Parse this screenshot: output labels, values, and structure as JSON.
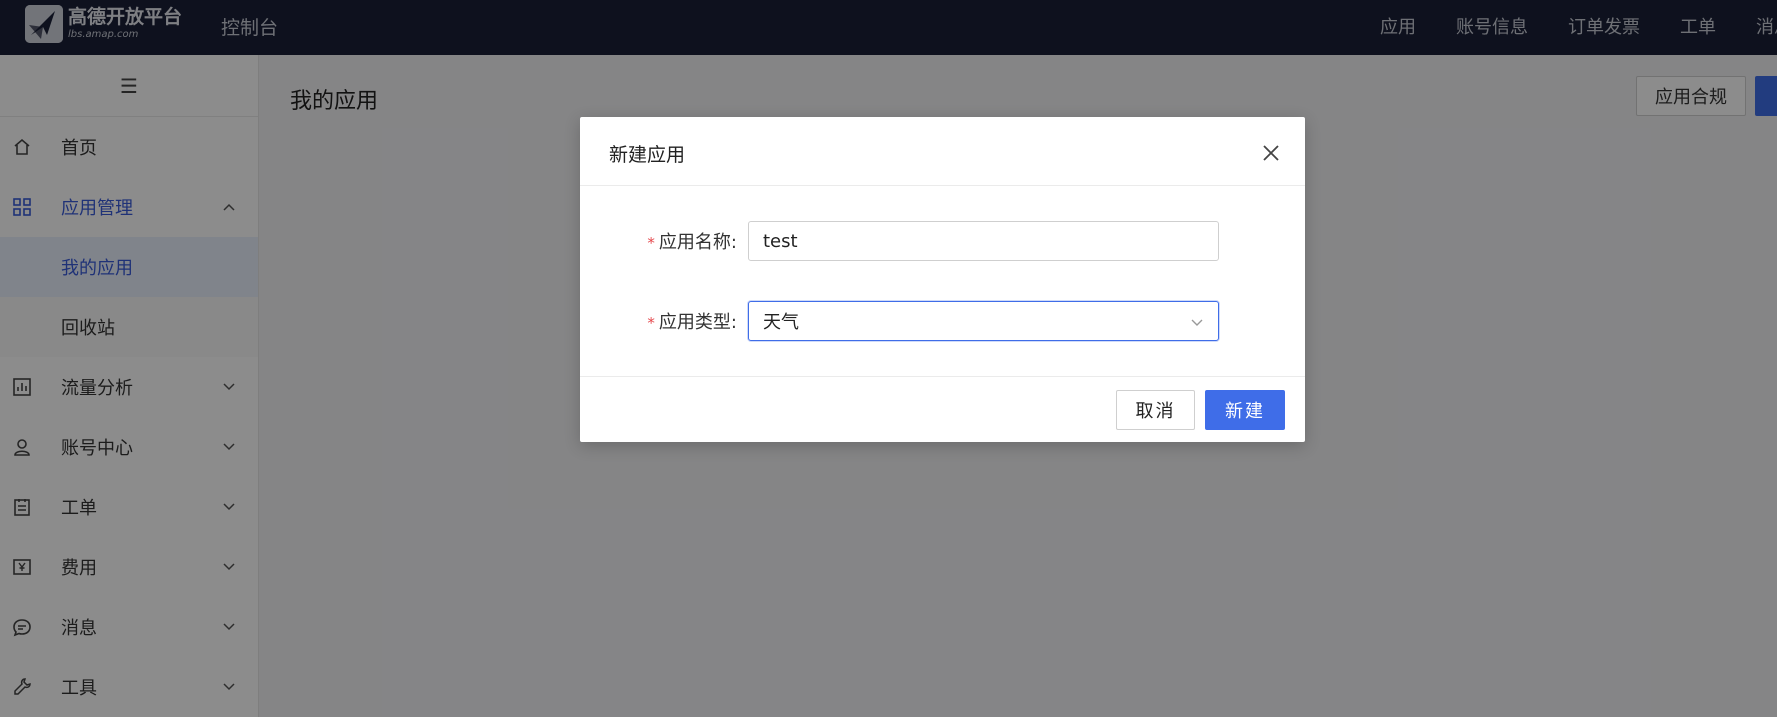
{
  "topbar": {
    "logo_cn": "高德开放平台",
    "logo_en": "lbs.amap.com",
    "console": "控制台",
    "nav": [
      "应用",
      "账号信息",
      "订单发票",
      "工单",
      "消息"
    ]
  },
  "sidebar": {
    "items": [
      {
        "label": "首页",
        "icon": "home-icon"
      },
      {
        "label": "应用管理",
        "icon": "grid-icon",
        "expanded": true
      },
      {
        "label": "我的应用",
        "sub": true,
        "selected": true
      },
      {
        "label": "回收站",
        "sub": true
      },
      {
        "label": "流量分析",
        "icon": "chart-icon"
      },
      {
        "label": "账号中心",
        "icon": "user-icon"
      },
      {
        "label": "工单",
        "icon": "ticket-icon"
      },
      {
        "label": "费用",
        "icon": "yen-icon"
      },
      {
        "label": "消息",
        "icon": "message-icon"
      },
      {
        "label": "工具",
        "icon": "wrench-icon"
      }
    ]
  },
  "main": {
    "title": "我的应用",
    "compliance_button": "应用合规"
  },
  "dialog": {
    "title": "新建应用",
    "name_label": "应用名称:",
    "name_value": "test",
    "type_label": "应用类型:",
    "type_value": "天气",
    "cancel_label": "取消",
    "create_label": "新建"
  },
  "colors": {
    "topbar_bg": "#1a2038",
    "accent": "#3f6de8",
    "required": "#e5484d"
  }
}
